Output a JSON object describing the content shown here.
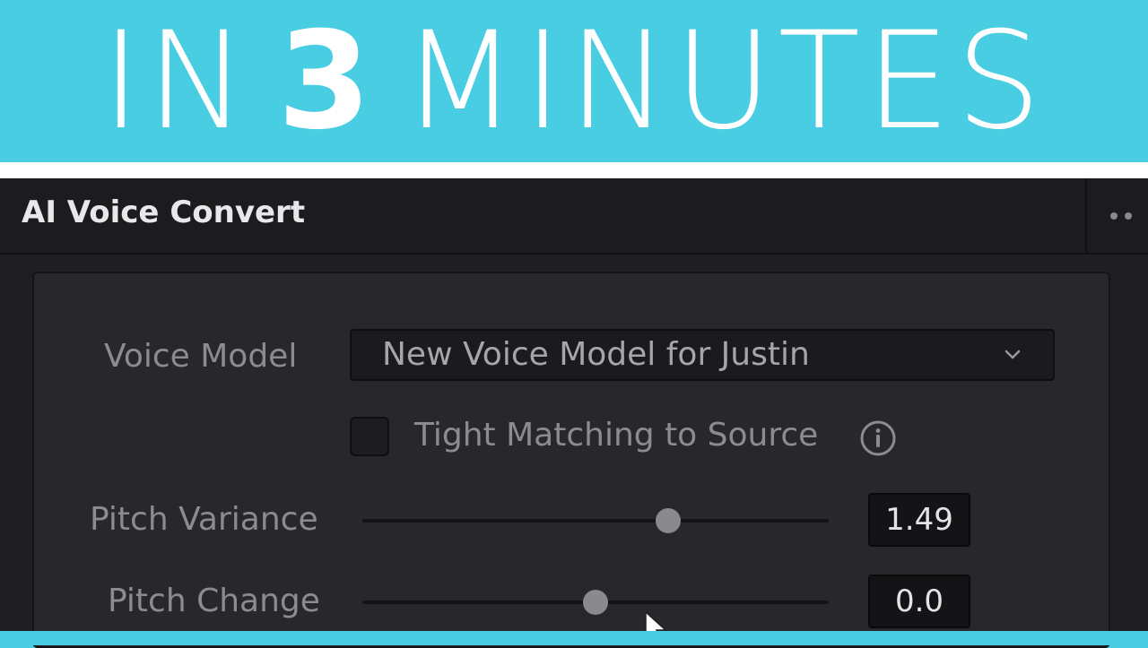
{
  "banner": {
    "before": "IN",
    "number": "3",
    "after": "MINUTES"
  },
  "panel": {
    "title": "AI Voice Convert",
    "voice_model": {
      "label": "Voice Model",
      "value": "New Voice Model for Justin"
    },
    "tight_matching": {
      "label": "Tight Matching to Source",
      "checked": false
    },
    "pitch_variance": {
      "label": "Pitch Variance",
      "value": "1.49",
      "slider_fraction": 0.655
    },
    "pitch_change": {
      "label": "Pitch Change",
      "value": "0.0",
      "slider_fraction": 0.5
    }
  },
  "icons": {
    "more": "more-dots-icon",
    "dropdown": "chevron-down-icon",
    "info": "info-icon",
    "cursor": "mouse-cursor-icon"
  },
  "colors": {
    "accent": "#49cde3",
    "panel_bg": "#1f1f22",
    "inner_bg": "#28282c",
    "label": "#8b8b90",
    "thumb": "#8a8a8e"
  }
}
